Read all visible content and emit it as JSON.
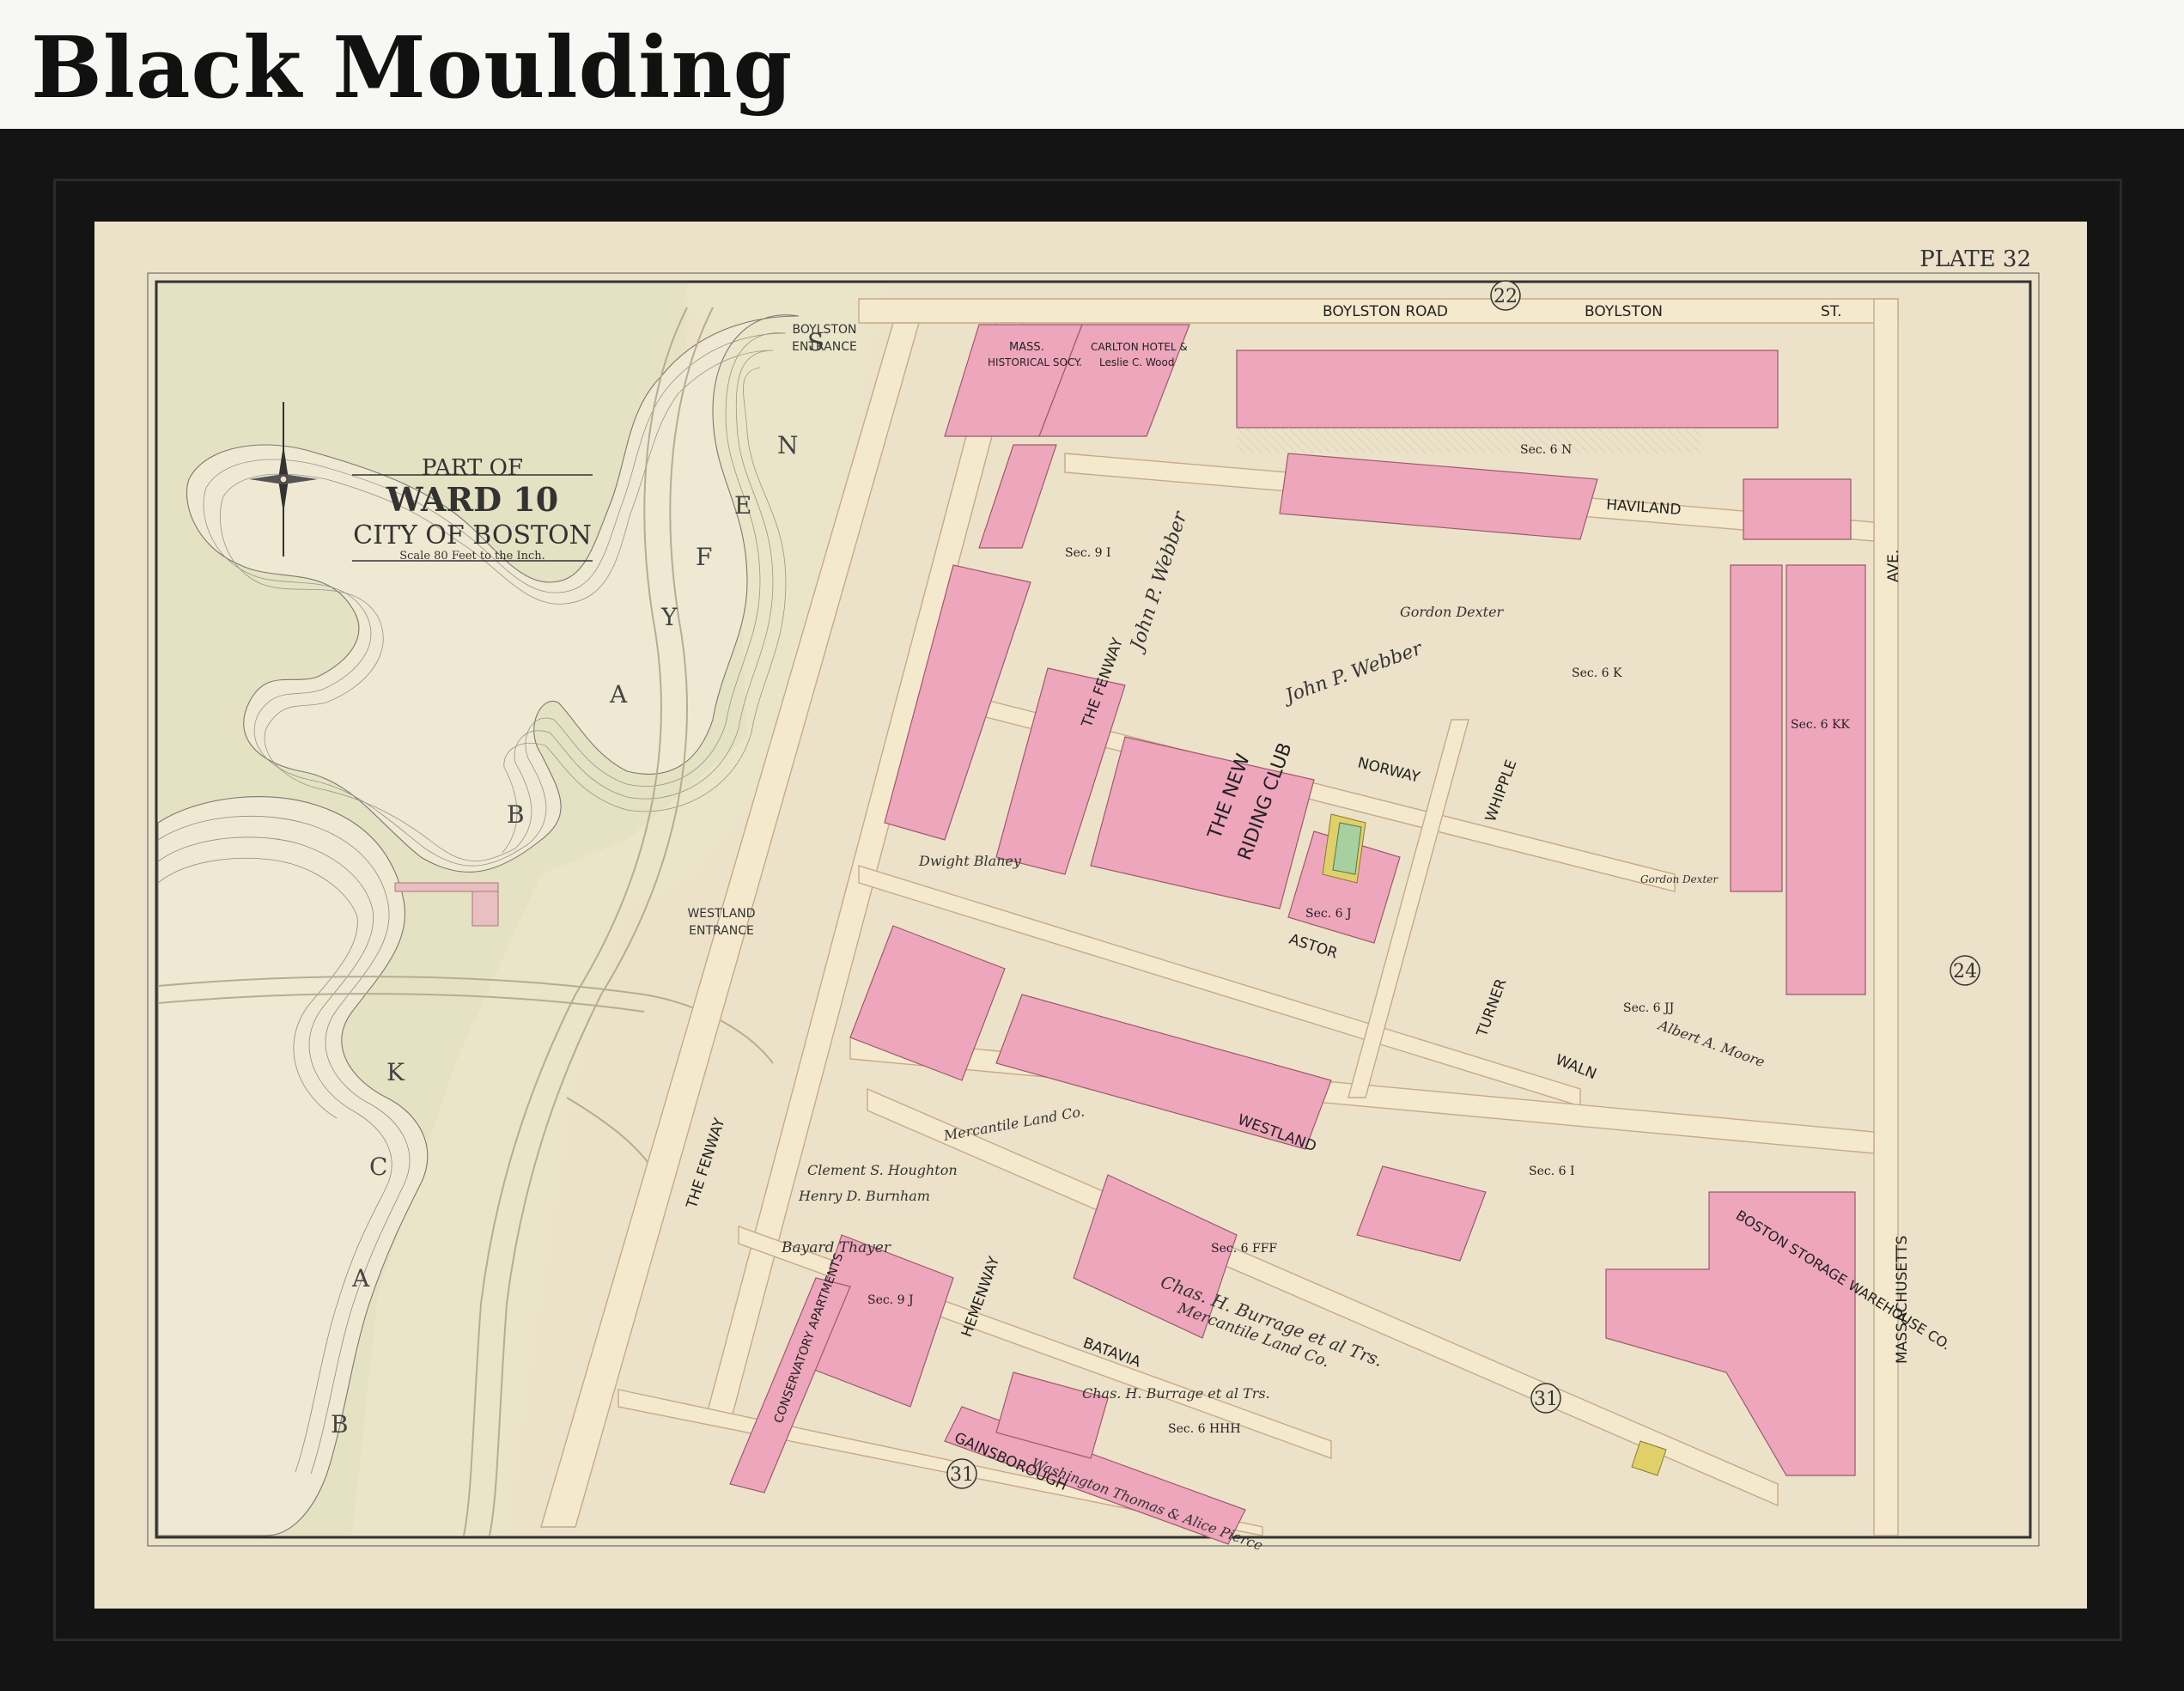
{
  "header": {
    "title": "Black Moulding"
  },
  "map": {
    "plate_label": "PLATE 32",
    "cartouche": {
      "line1": "PART OF",
      "line2": "WARD 10",
      "line3": "CITY OF BOSTON",
      "scale": "Scale 80 Feet to the Inch."
    },
    "ward_numbers": [
      "22",
      "24",
      "31",
      "31",
      "31"
    ],
    "fens_label": [
      "S",
      "N",
      "E",
      "F",
      "Y",
      "A",
      "B"
    ],
    "back_label": [
      "K",
      "C",
      "A",
      "B"
    ],
    "entrances": {
      "boylston": [
        "BOYLSTON",
        "ENTRANCE"
      ],
      "westland": [
        "WESTLAND",
        "ENTRANCE"
      ]
    },
    "streets": {
      "boylston_road": "BOYLSTON  ROAD",
      "boylston_st": "BOYLSTON",
      "st": "ST.",
      "haviland": "HAVILAND",
      "norway": "NORWAY",
      "astor": "ASTOR",
      "westland": "WESTLAND",
      "batavia": "BATAVIA",
      "gainsborough": "GAINSBOROUGH",
      "hemenway": "HEMENWAY",
      "the_fenway_1": "THE FENWAY",
      "the_fenway_2": "THE FENWAY",
      "whipple": "WHIPPLE",
      "turner": "TURNER",
      "waln": "WALN",
      "massachusetts": "MASSACHUSETTS",
      "ave": "AVE."
    },
    "buildings": {
      "riding_club": [
        "THE NEW",
        "RIDING CLUB"
      ],
      "storage": "BOSTON STORAGE WAREHOUSE CO.",
      "mass_hist": [
        "MASS.",
        "HISTORICAL SOCY."
      ],
      "carlton": [
        "CARLTON HOTEL &",
        "Leslie C. Wood"
      ],
      "conservatory": "CONSERVATORY APARTMENTS"
    },
    "owners": {
      "webber1": "John P. Webber",
      "webber2": "John P. Webber",
      "dexter": "Gordon Dexter",
      "dexter2": "Gordon Dexter",
      "mercantile1": "Mercantile Land Co.",
      "mercantile2": "Chas. H. Burrage et al Trs.",
      "mercantile3": "Mercantile Land Co.",
      "burrage": "Chas. H. Burrage et al Trs.",
      "thayer": "Bayard Thayer",
      "burnham": "Henry D. Burnham",
      "boughton": "Clement S. Houghton",
      "dwight": "Dwight Blaney",
      "sec91": "Sec. 9 I",
      "sec6k": "Sec. 6 K",
      "sec6n": "Sec. 6 N",
      "sec6kk": "Sec. 6 KK",
      "sec6j": "Sec. 6 J",
      "sec6jj": "Sec. 6 JJ",
      "sec6i": "Sec. 6 I",
      "sec6fff": "Sec. 6 FFF",
      "sec93": "Sec. 9 J",
      "sec6hhh": "Sec. 6 HHH",
      "moore": "Albert A. Moore",
      "washington": "Washington Thomas & Alice Pierce"
    }
  },
  "colors": {
    "frame": "#141414",
    "paper": "#ece2c9",
    "parcel_pink": "#eea6bd",
    "fens_green": "#e6e4c4",
    "street": "#f3e6c8"
  }
}
